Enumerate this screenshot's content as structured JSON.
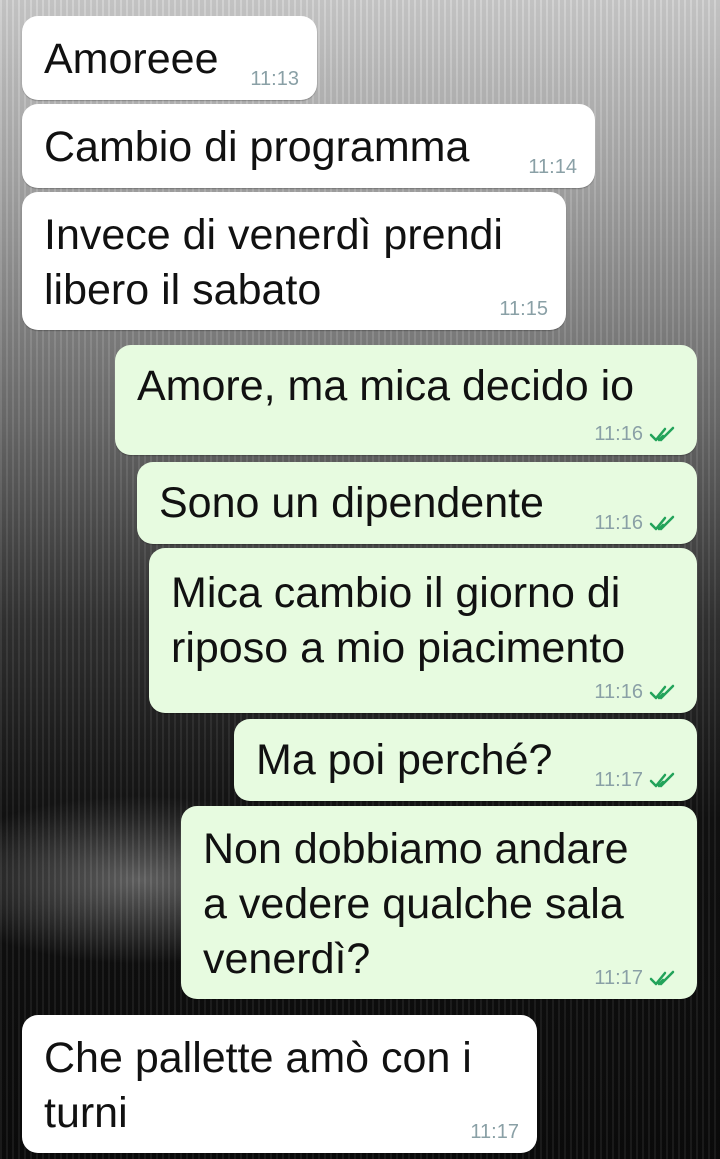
{
  "messages": [
    {
      "dir": "in",
      "lines": [
        "Amoreee"
      ],
      "time": "11:13"
    },
    {
      "dir": "in",
      "lines": [
        "Cambio di programma"
      ],
      "time": "11:14"
    },
    {
      "dir": "in",
      "lines": [
        "Invece di venerdì prendi",
        "libero il sabato"
      ],
      "time": "11:15"
    },
    {
      "dir": "out",
      "lines": [
        "Amore, ma mica decido io"
      ],
      "time": "11:16",
      "status": "read"
    },
    {
      "dir": "out",
      "lines": [
        "Sono un dipendente"
      ],
      "time": "11:16",
      "status": "read"
    },
    {
      "dir": "out",
      "lines": [
        "Mica cambio il giorno di",
        "riposo a mio piacimento"
      ],
      "time": "11:16",
      "status": "read"
    },
    {
      "dir": "out",
      "lines": [
        "Ma poi perché?"
      ],
      "time": "11:17",
      "status": "read"
    },
    {
      "dir": "out",
      "lines": [
        "Non dobbiamo andare",
        "a vedere qualche sala",
        "venerdì?"
      ],
      "time": "11:17",
      "status": "read"
    },
    {
      "dir": "in",
      "lines": [
        "Che pallette amò con i",
        "turni"
      ],
      "time": "11:17"
    }
  ],
  "colors": {
    "incoming_bubble": "#ffffff",
    "outgoing_bubble": "#e7fbe0",
    "read_ticks": "#34b7f1"
  }
}
